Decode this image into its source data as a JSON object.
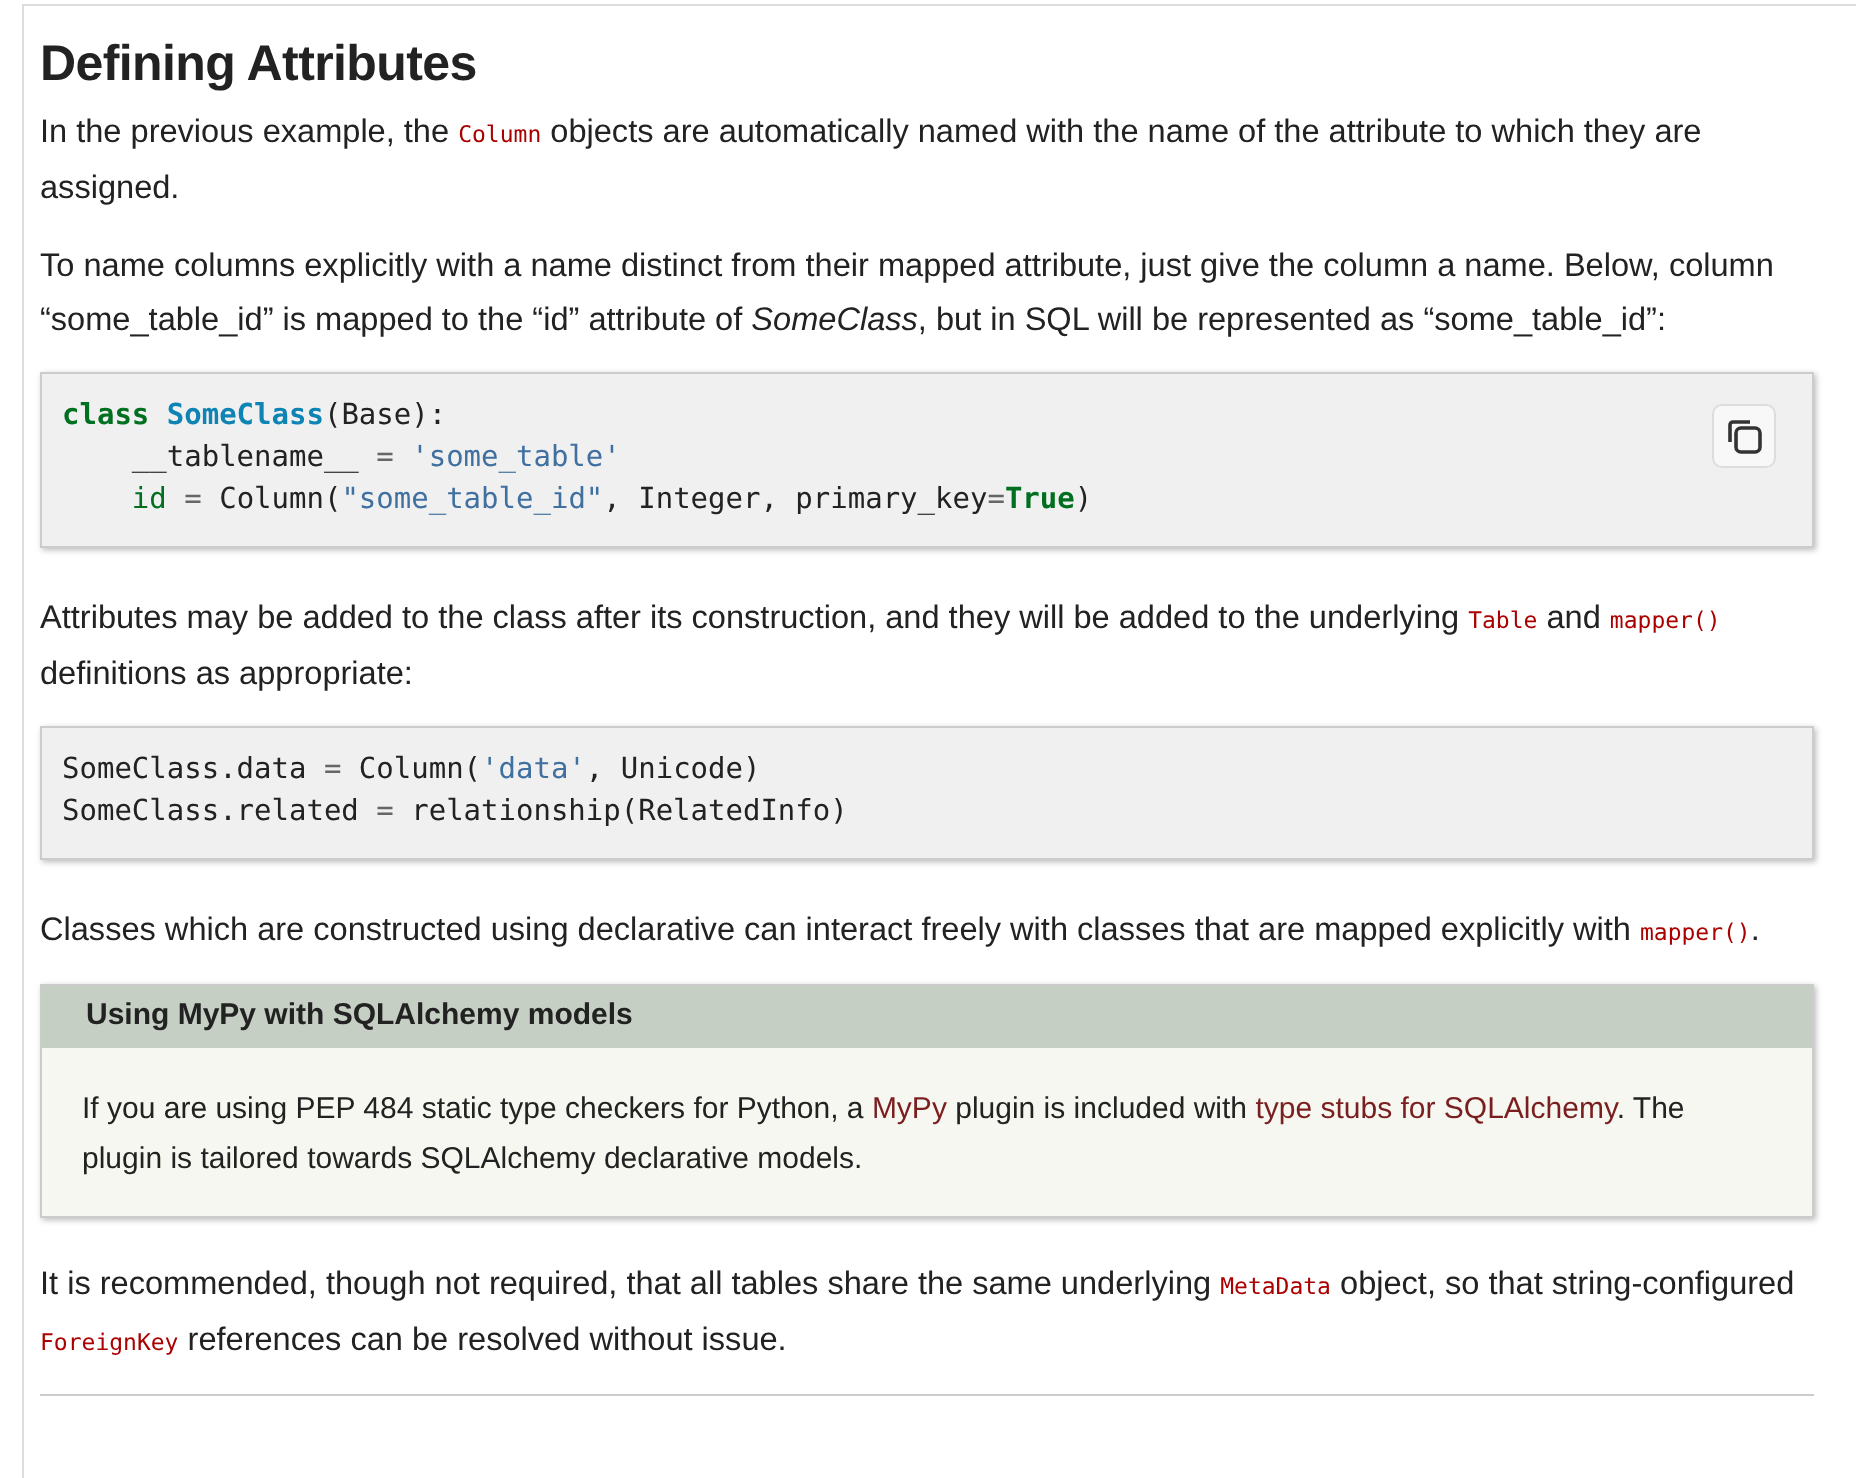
{
  "title": "Defining Attributes",
  "blocks": [
    {
      "kind": "paragraph",
      "segments": [
        {
          "kind": "text",
          "text": "In the previous example, the "
        },
        {
          "kind": "code",
          "text": "Column"
        },
        {
          "kind": "text",
          "text": " objects are automatically named with the name of the attribute to which they are assigned."
        }
      ]
    },
    {
      "kind": "paragraph",
      "segments": [
        {
          "kind": "text",
          "text": "To name columns explicitly with a name distinct from their mapped attribute, just give the column a name. Below, column “some_table_id” is mapped to the “id” attribute of "
        },
        {
          "kind": "italic",
          "text": "SomeClass"
        },
        {
          "kind": "text",
          "text": ", but in SQL will be represented as “some_table_id”:"
        }
      ]
    },
    {
      "kind": "code_block",
      "copy_button": true,
      "lines": [
        [
          {
            "kind": "keyword",
            "text": "class"
          },
          {
            "kind": "classname",
            "text": " SomeClass"
          },
          {
            "kind": "plain",
            "text": "(Base):"
          }
        ],
        [
          {
            "kind": "plain",
            "text": "    __tablename__ "
          },
          {
            "kind": "operator",
            "text": "="
          },
          {
            "kind": "string",
            "text": " 'some_table'"
          }
        ],
        [
          {
            "kind": "name",
            "text": "    id"
          },
          {
            "kind": "operator",
            "text": " ="
          },
          {
            "kind": "plain",
            "text": " Column("
          },
          {
            "kind": "string",
            "text": "\"some_table_id\""
          },
          {
            "kind": "plain",
            "text": ", Integer, primary_key"
          },
          {
            "kind": "operator",
            "text": "="
          },
          {
            "kind": "keyword",
            "text": "True"
          },
          {
            "kind": "plain",
            "text": ")"
          }
        ]
      ]
    },
    {
      "kind": "paragraph",
      "segments": [
        {
          "kind": "text",
          "text": "Attributes may be added to the class after its construction, and they will be added to the underlying "
        },
        {
          "kind": "code",
          "text": "Table"
        },
        {
          "kind": "text",
          "text": " and "
        },
        {
          "kind": "code",
          "text": "mapper()"
        },
        {
          "kind": "text",
          "text": " definitions as appropriate:"
        }
      ]
    },
    {
      "kind": "code_block",
      "copy_button": false,
      "lines": [
        [
          {
            "kind": "plain",
            "text": "SomeClass.data "
          },
          {
            "kind": "operator",
            "text": "="
          },
          {
            "kind": "plain",
            "text": " Column("
          },
          {
            "kind": "string",
            "text": "'data'"
          },
          {
            "kind": "plain",
            "text": ", Unicode)"
          }
        ],
        [
          {
            "kind": "plain",
            "text": "SomeClass.related "
          },
          {
            "kind": "operator",
            "text": "="
          },
          {
            "kind": "plain",
            "text": " relationship(RelatedInfo)"
          }
        ]
      ]
    },
    {
      "kind": "paragraph",
      "segments": [
        {
          "kind": "text",
          "text": "Classes which are constructed using declarative can interact freely with classes that are mapped explicitly with "
        },
        {
          "kind": "code",
          "text": "mapper()"
        },
        {
          "kind": "text",
          "text": "."
        }
      ]
    },
    {
      "kind": "note",
      "title": "Using MyPy with SQLAlchemy models",
      "segments": [
        {
          "kind": "text",
          "text": "If you are using PEP 484 static type checkers for Python, a "
        },
        {
          "kind": "link",
          "text": "MyPy"
        },
        {
          "kind": "text",
          "text": " plugin is included with "
        },
        {
          "kind": "link",
          "text": "type stubs for SQLAlchemy"
        },
        {
          "kind": "text",
          "text": ". The plugin is tailored towards SQLAlchemy declarative models."
        }
      ]
    },
    {
      "kind": "paragraph",
      "segments": [
        {
          "kind": "text",
          "text": "It is recommended, though not required, that all tables share the same underlying "
        },
        {
          "kind": "code",
          "text": "MetaData"
        },
        {
          "kind": "text",
          "text": " object, so that string-configured "
        },
        {
          "kind": "code",
          "text": "ForeignKey"
        },
        {
          "kind": "text",
          "text": " references can be resolved without issue."
        }
      ]
    }
  ]
}
